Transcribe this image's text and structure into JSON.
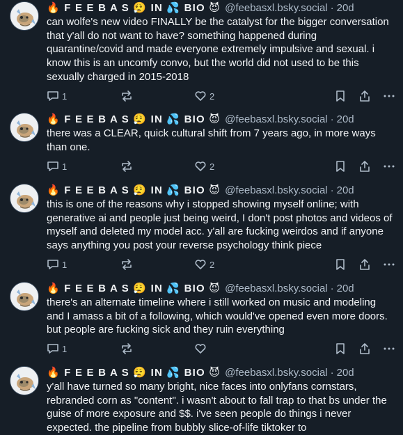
{
  "posts": [
    {
      "display_name": "🔥 F E E B A S 😮‍💨 IN 💦 BIO 😈",
      "handle": "@feebasxl.bsky.social",
      "separator": "·",
      "time": "20d",
      "text": "can wolfe's new video FINALLY be the catalyst for the bigger conversation that y'all do not want to have? something happened during quarantine/covid and made everyone extremely impulsive and sexual. i know this is an uncomfy convo, but the world did not used to be this sexually charged in 2015-2018",
      "reply_count": "1",
      "repost_count": "",
      "like_count": "2"
    },
    {
      "display_name": "🔥 F E E B A S 😮‍💨 IN 💦 BIO 😈",
      "handle": "@feebasxl.bsky.social",
      "separator": "·",
      "time": "20d",
      "text": "there was a CLEAR, quick cultural shift from 7 years ago, in more ways than one.",
      "reply_count": "1",
      "repost_count": "",
      "like_count": "2"
    },
    {
      "display_name": "🔥 F E E B A S 😮‍💨 IN 💦 BIO 😈",
      "handle": "@feebasxl.bsky.social",
      "separator": "·",
      "time": "20d",
      "text": "this is one of the reasons why i stopped showing myself online; with generative ai and people just being weird, I don't post photos and videos of myself and deleted my model acc. y'all are fucking weirdos and if anyone says anything you post your reverse psychology think piece",
      "reply_count": "1",
      "repost_count": "",
      "like_count": "2"
    },
    {
      "display_name": "🔥 F E E B A S 😮‍💨 IN 💦 BIO 😈",
      "handle": "@feebasxl.bsky.social",
      "separator": "·",
      "time": "20d",
      "text": "there's an alternate timeline where i still worked on music and modeling and I amass a bit of a following, which would've opened even more doors. but people are fucking sick and they ruin everything",
      "reply_count": "1",
      "repost_count": "",
      "like_count": ""
    },
    {
      "display_name": "🔥 F E E B A S 😮‍💨 IN 💦 BIO 😈",
      "handle": "@feebasxl.bsky.social",
      "separator": "·",
      "time": "20d",
      "text": "y'all have turned so many bright, nice faces into onlyfans cornstars, rebranded corn as \"content\". i wasn't about to fall trap to that bs under the guise of more exposure and $$. i've seen people do things i never expected. the pipeline from bubbly slice-of-life tiktoker to",
      "reply_count": "",
      "repost_count": "",
      "like_count": ""
    }
  ],
  "icons": {
    "avatar": "feebas-avatar",
    "reply": "reply-icon",
    "repost": "repost-icon",
    "like": "heart-icon",
    "bookmark": "bookmark-icon",
    "share": "share-icon",
    "more": "more-icon"
  },
  "colors": {
    "background": "#161e27",
    "text": "#f1f3f5",
    "muted": "#aebbc9",
    "divider": "#2e4052"
  }
}
